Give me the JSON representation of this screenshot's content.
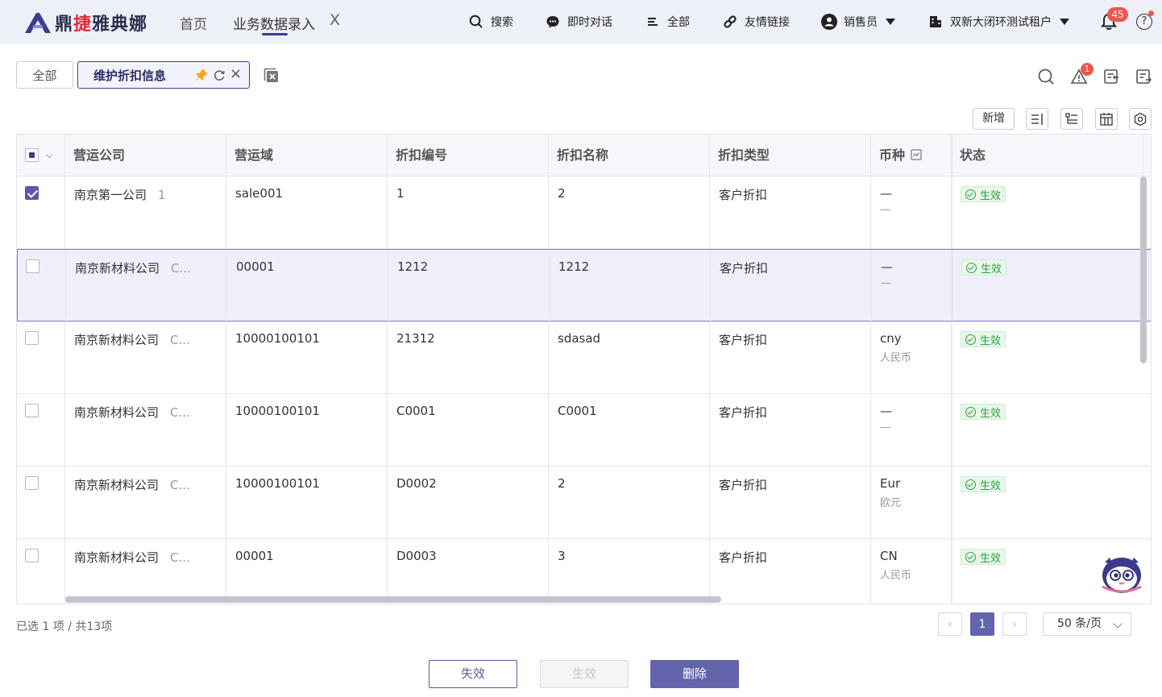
{
  "app": {
    "logo_prefix": "鼎",
    "logo_red": "捷",
    "logo_suffix": "雅典娜",
    "nav_home": "首页",
    "nav_current": "业务数据录入",
    "nav_close": "X"
  },
  "tools": {
    "search": "搜索",
    "chat": "即时对话",
    "all": "全部",
    "links": "友情链接",
    "role": "销售员",
    "tenant": "双新大闭环测试租户",
    "notifications": "45",
    "help": "?"
  },
  "page_tabs": {
    "all": "全部",
    "current": "维护折扣信息",
    "close": "×"
  },
  "right_icons": {
    "alert_badge": "1"
  },
  "toolbar": {
    "new_label": "新增"
  },
  "table": {
    "headers": [
      "营运公司",
      "营运域",
      "折扣编号",
      "折扣名称",
      "折扣类型",
      "币种",
      "状态"
    ],
    "rows": [
      {
        "company": "南京第一公司",
        "company_code": "1",
        "domain": "sale001",
        "code": "1",
        "name": "2",
        "type": "客户折扣",
        "currency": "—",
        "currency_name": "—",
        "status": "生效",
        "checked": true
      },
      {
        "company": "南京新材料公司",
        "company_code": "C...",
        "domain": "00001",
        "code": "1212",
        "name": "1212",
        "type": "客户折扣",
        "currency": "—",
        "currency_name": "—",
        "status": "生效",
        "checked": false
      },
      {
        "company": "南京新材料公司",
        "company_code": "C...",
        "domain": "10000100101",
        "code": "21312",
        "name": "sdasad",
        "type": "客户折扣",
        "currency": "cny",
        "currency_name": "人民币",
        "status": "生效",
        "checked": false
      },
      {
        "company": "南京新材料公司",
        "company_code": "C...",
        "domain": "10000100101",
        "code": "C0001",
        "name": "C0001",
        "type": "客户折扣",
        "currency": "—",
        "currency_name": "—",
        "status": "生效",
        "checked": false
      },
      {
        "company": "南京新材料公司",
        "company_code": "C...",
        "domain": "10000100101",
        "code": "D0002",
        "name": "2",
        "type": "客户折扣",
        "currency": "Eur",
        "currency_name": "欧元",
        "status": "生效",
        "checked": false
      },
      {
        "company": "南京新材料公司",
        "company_code": "C...",
        "domain": "00001",
        "code": "D0003",
        "name": "3",
        "type": "客户折扣",
        "currency": "CN",
        "currency_name": "人民币",
        "status": "生效",
        "checked": false
      }
    ]
  },
  "footer": {
    "selected_prefix": "已选 ",
    "selected_count": "1",
    "selected_suffix": " 项 / 共13项",
    "prev": "‹",
    "page": "1",
    "next": "›",
    "page_size": "50 条/页",
    "btn_disable": "失效",
    "btn_enable": "生效",
    "btn_delete": "删除"
  },
  "colors": {
    "accent": "#5a5aa8",
    "status_green": "#2ba244",
    "badge_red": "#f0554f"
  }
}
